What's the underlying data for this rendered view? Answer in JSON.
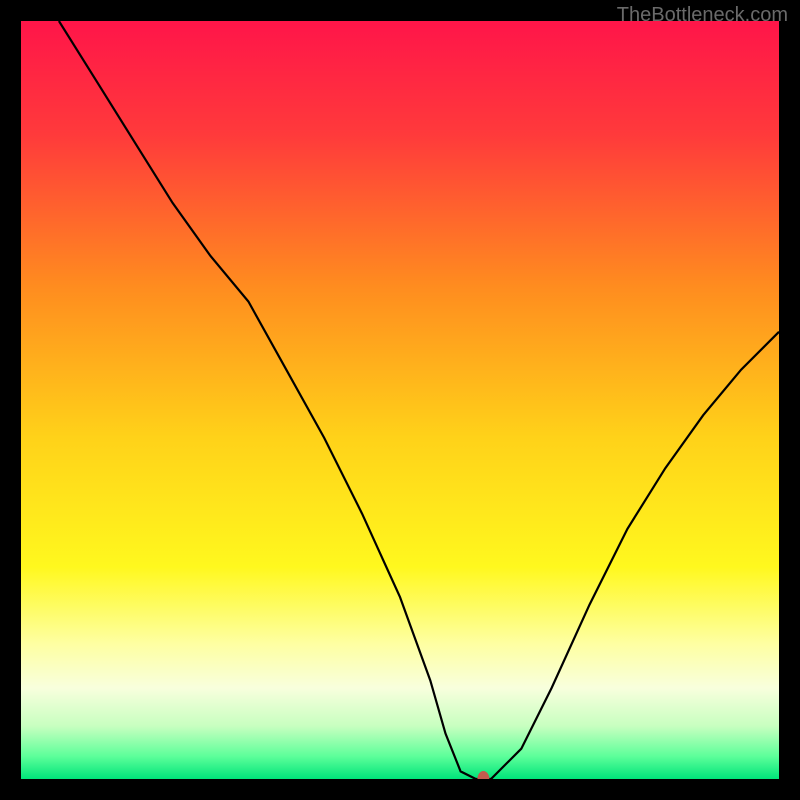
{
  "watermark": "TheBottleneck.com",
  "chart_data": {
    "type": "line",
    "title": "",
    "xlabel": "",
    "ylabel": "",
    "xlim": [
      0,
      100
    ],
    "ylim": [
      0,
      100
    ],
    "background_gradient": {
      "stops": [
        {
          "offset": 0,
          "color": "#ff1549"
        },
        {
          "offset": 15,
          "color": "#ff3a3b"
        },
        {
          "offset": 35,
          "color": "#ff8c1f"
        },
        {
          "offset": 55,
          "color": "#ffd219"
        },
        {
          "offset": 72,
          "color": "#fff81e"
        },
        {
          "offset": 82,
          "color": "#feffa0"
        },
        {
          "offset": 88,
          "color": "#f8ffdd"
        },
        {
          "offset": 93,
          "color": "#c8ffc0"
        },
        {
          "offset": 97,
          "color": "#5dff9a"
        },
        {
          "offset": 100,
          "color": "#00e47a"
        }
      ]
    },
    "series": [
      {
        "name": "bottleneck-curve",
        "color": "#000000",
        "x": [
          5,
          10,
          15,
          20,
          25,
          30,
          35,
          40,
          45,
          50,
          54,
          56,
          58,
          60,
          62,
          66,
          70,
          75,
          80,
          85,
          90,
          95,
          100
        ],
        "y": [
          100,
          92,
          84,
          76,
          69,
          63,
          54,
          45,
          35,
          24,
          13,
          6,
          1,
          0,
          0,
          4,
          12,
          23,
          33,
          41,
          48,
          54,
          59
        ]
      }
    ],
    "marker": {
      "name": "optimal-point",
      "x": 61,
      "y": 0,
      "color": "#c25b4e",
      "rx": 6,
      "ry": 8
    }
  }
}
